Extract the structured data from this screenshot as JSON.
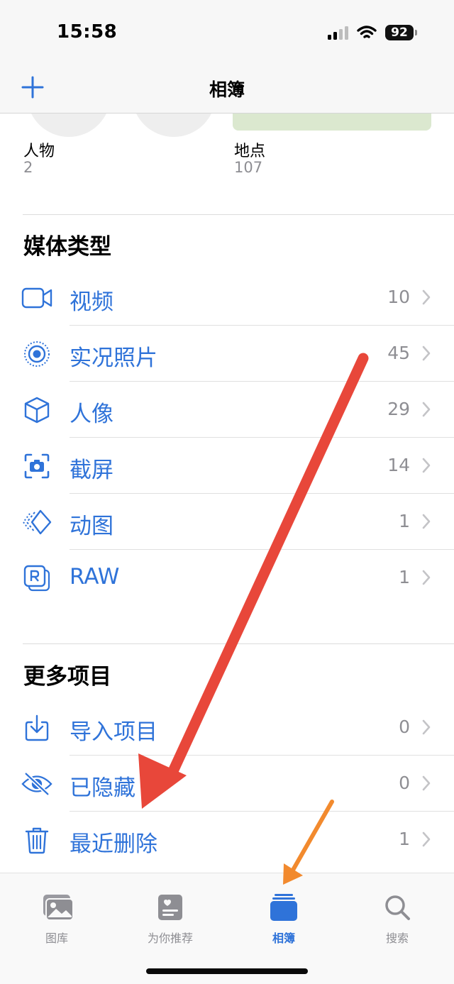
{
  "status_bar": {
    "time": "15:58",
    "battery": "92"
  },
  "nav": {
    "title": "相簿"
  },
  "people_places": {
    "people_label": "人物",
    "people_count": "2",
    "places_label": "地点",
    "places_count": "107"
  },
  "media_types": {
    "title": "媒体类型",
    "items": [
      {
        "label": "视频",
        "count": "10",
        "icon": "video-icon"
      },
      {
        "label": "实况照片",
        "count": "45",
        "icon": "live-photo-icon"
      },
      {
        "label": "人像",
        "count": "29",
        "icon": "portrait-cube-icon"
      },
      {
        "label": "截屏",
        "count": "14",
        "icon": "screenshot-icon"
      },
      {
        "label": "动图",
        "count": "1",
        "icon": "animated-icon"
      },
      {
        "label": "RAW",
        "count": "1",
        "icon": "raw-icon"
      }
    ]
  },
  "more_items": {
    "title": "更多项目",
    "items": [
      {
        "label": "导入项目",
        "count": "0",
        "icon": "import-icon"
      },
      {
        "label": "已隐藏",
        "count": "0",
        "icon": "hidden-eye-icon"
      },
      {
        "label": "最近删除",
        "count": "1",
        "icon": "trash-icon"
      }
    ]
  },
  "tab_bar": {
    "tabs": [
      {
        "label": "图库",
        "icon": "library-icon",
        "active": false
      },
      {
        "label": "为你推荐",
        "icon": "for-you-icon",
        "active": false
      },
      {
        "label": "相簿",
        "icon": "albums-icon",
        "active": true
      },
      {
        "label": "搜索",
        "icon": "search-icon",
        "active": false
      }
    ]
  },
  "colors": {
    "accent": "#2f73d9",
    "secondary_text": "#8e8e93",
    "annotation_red": "#e8473a",
    "annotation_orange": "#f28a2e"
  }
}
